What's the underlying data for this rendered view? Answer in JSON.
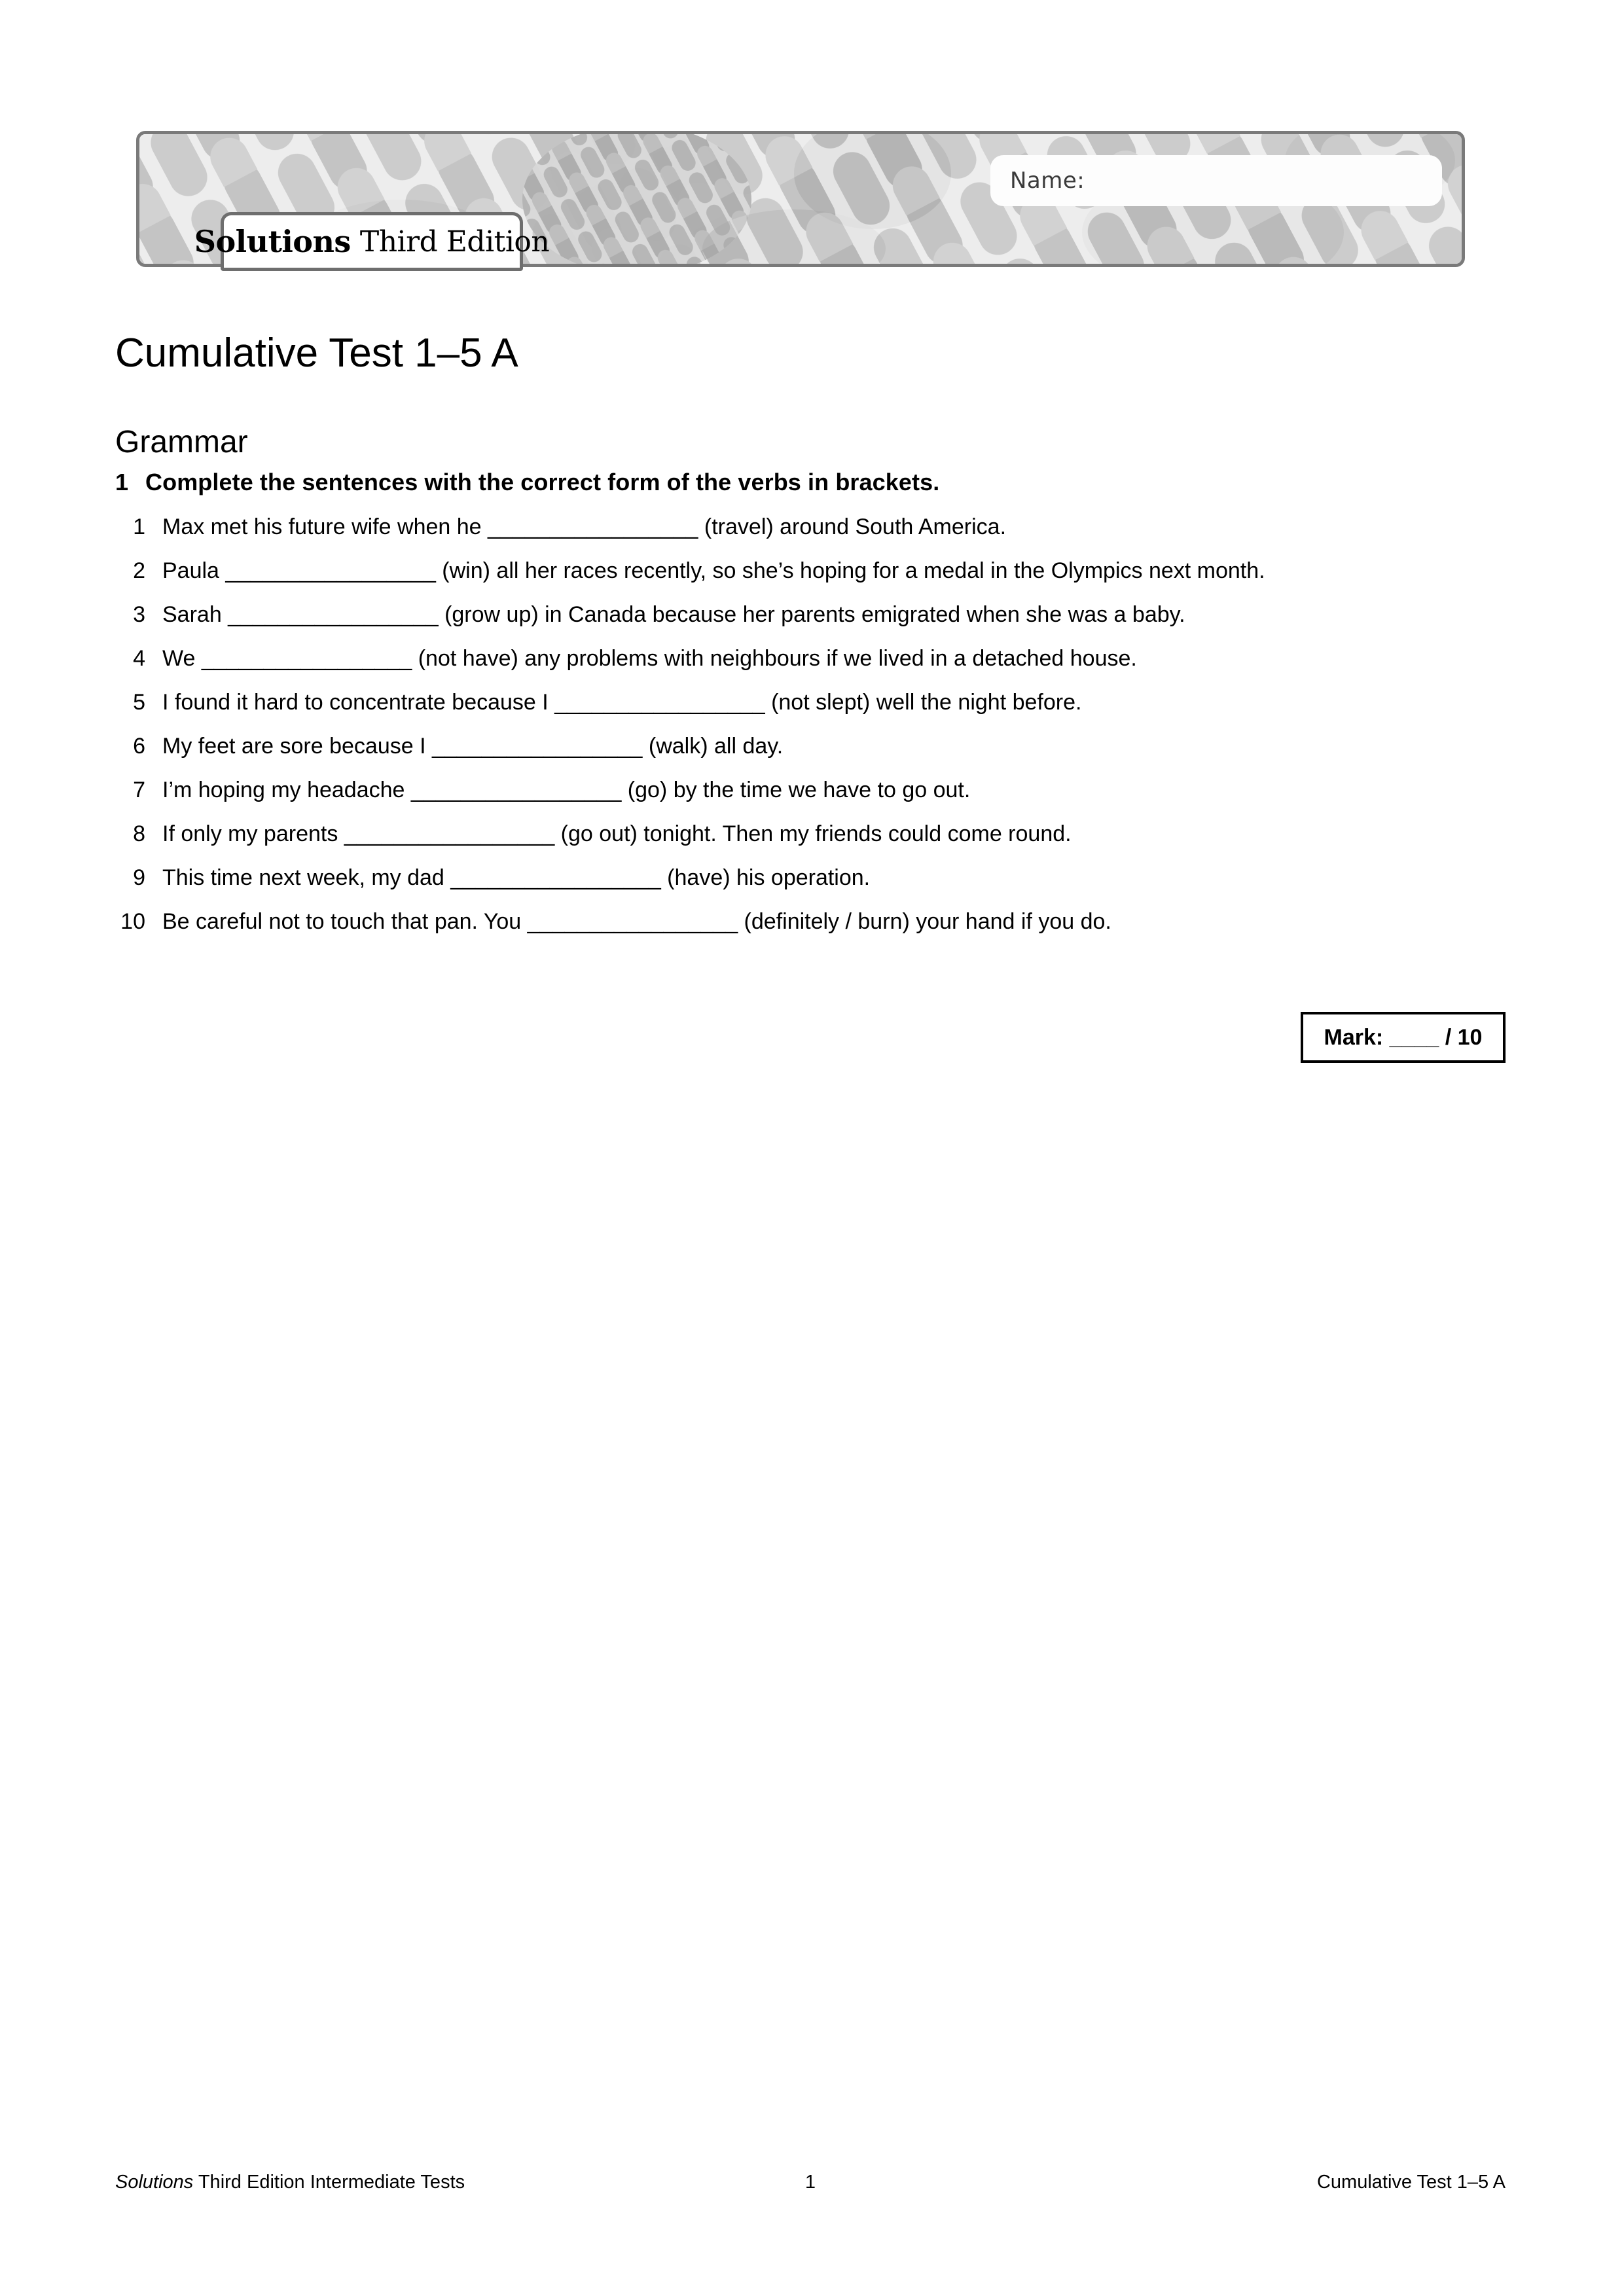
{
  "header": {
    "name_label": "Name:",
    "logo_primary": "Solutions",
    "logo_secondary": "Third Edition"
  },
  "title": "Cumulative Test 1–5 A",
  "section": "Grammar",
  "exercise": {
    "number": "1",
    "instruction": "Complete the sentences with the correct form of the verbs in brackets.",
    "items": [
      {
        "num": "1",
        "text": "Max met his future wife when he _________________ (travel) around South America."
      },
      {
        "num": "2",
        "text": "Paula _________________ (win) all her races recently, so she’s hoping for a medal in the Olympics next month."
      },
      {
        "num": "3",
        "text": "Sarah _________________ (grow up) in Canada because her parents emigrated when she was a baby."
      },
      {
        "num": "4",
        "text": "We _________________ (not have) any problems with neighbours if we lived in a detached house."
      },
      {
        "num": "5",
        "text": "I found it hard to concentrate because I _________________ (not slept) well the night before."
      },
      {
        "num": "6",
        "text": "My feet are sore because I _________________ (walk) all day."
      },
      {
        "num": "7",
        "text": "I’m hoping my headache _________________ (go) by the time we have to go out."
      },
      {
        "num": "8",
        "text": "If only my parents _________________ (go out) tonight. Then my friends could come round."
      },
      {
        "num": "9",
        "text": "This time next week, my dad _________________ (have) his operation."
      },
      {
        "num": "10",
        "text": "Be careful not to touch that pan. You _________________ (definitely / burn) your hand if you do."
      }
    ],
    "mark": "Mark: ____ / 10"
  },
  "footer": {
    "left_italic": "Solutions",
    "left_rest": " Third Edition Intermediate Tests",
    "center": "1",
    "right": "Cumulative Test 1–5 A"
  },
  "colors": {
    "banner_border": "#7a7a7a",
    "banner_bg": "#ececec",
    "pattern_light": "#e6e6e6",
    "pattern_mid": "#c9c9c9",
    "pattern_dark": "#a8a8a8",
    "text": "#000000"
  }
}
